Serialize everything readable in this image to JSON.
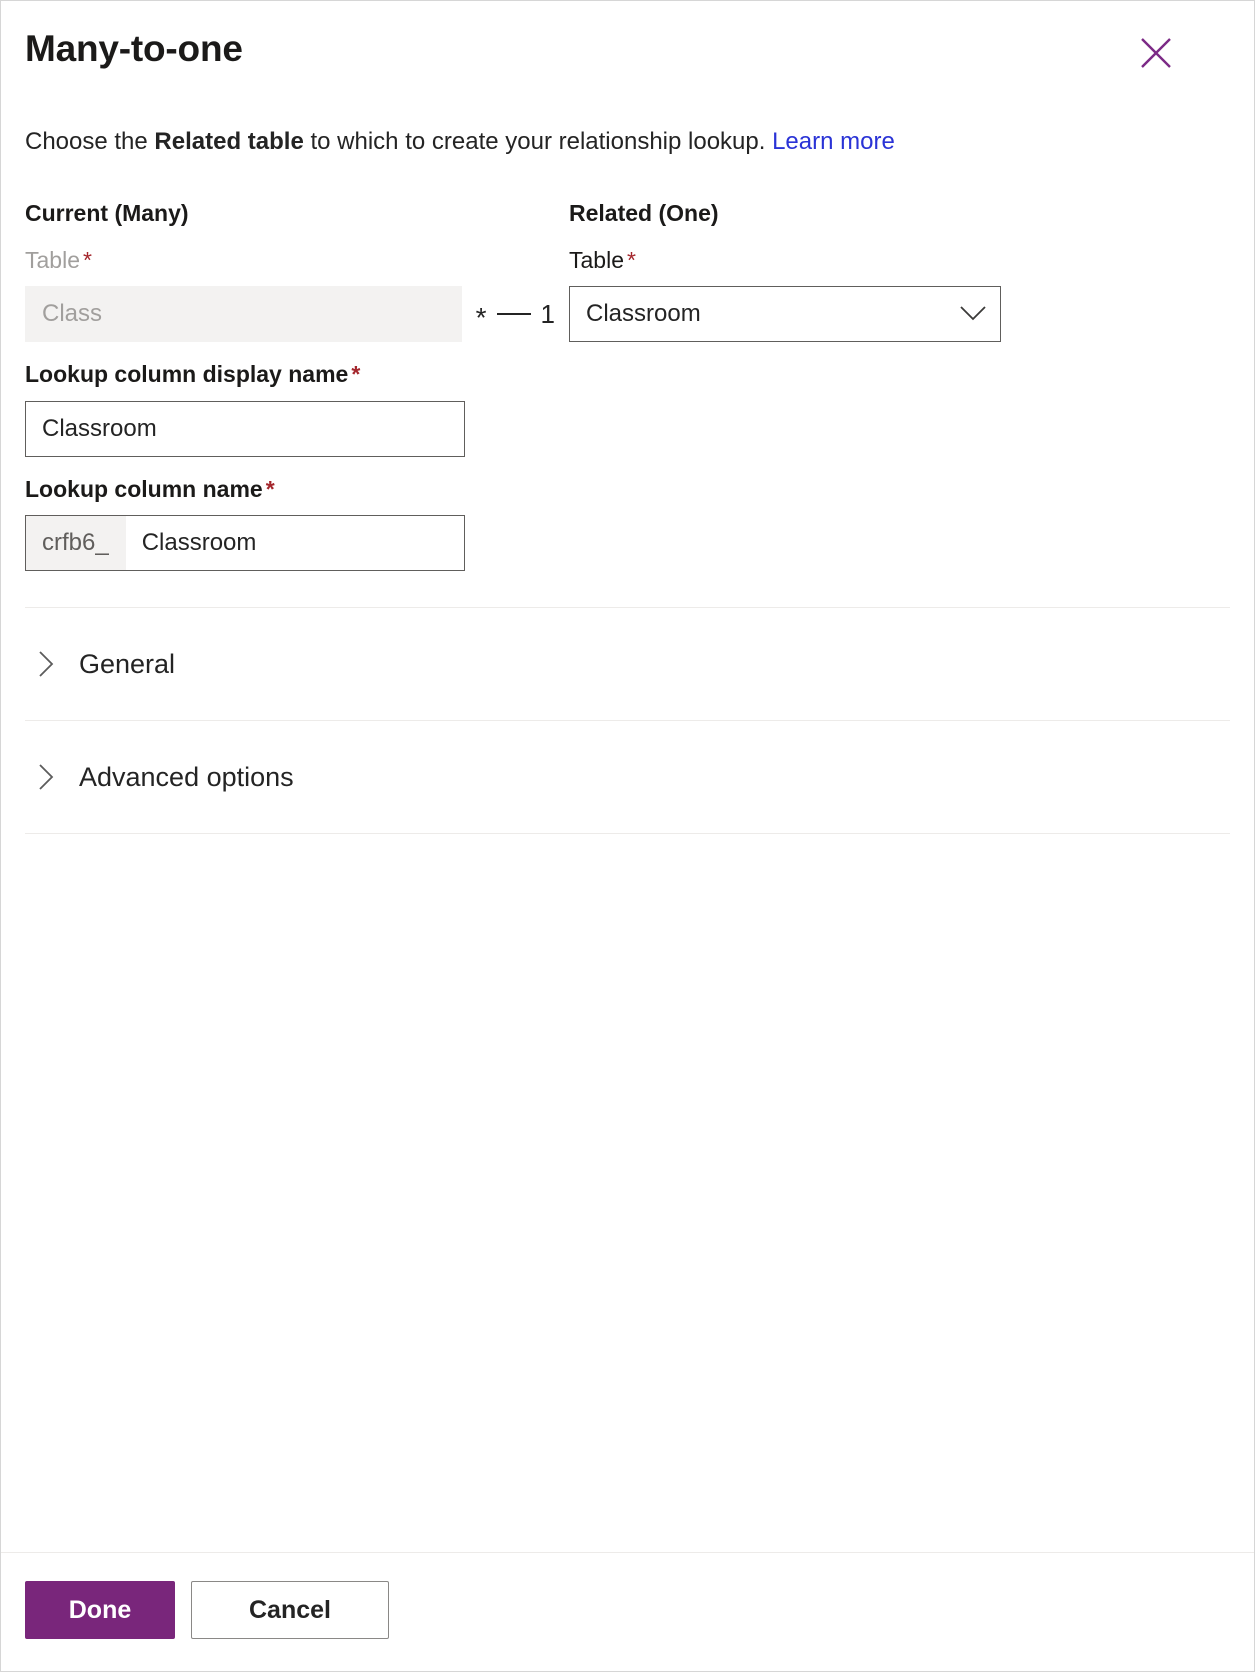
{
  "dialog": {
    "title": "Many-to-one",
    "close_icon": "close-icon",
    "subtitle": {
      "prefix": "Choose the ",
      "strong": "Related table",
      "suffix": " to which to create your relationship lookup. ",
      "link": "Learn more"
    }
  },
  "current": {
    "heading": "Current (Many)",
    "table_label": "Table",
    "required_mark": "*",
    "table_value": "Class"
  },
  "related": {
    "heading": "Related (One)",
    "table_label": "Table",
    "required_mark": "*",
    "table_value": "Classroom",
    "chevron_icon": "chevron-down-icon"
  },
  "cardinality": {
    "many": "*",
    "one": "1"
  },
  "lookup_display_name": {
    "label": "Lookup column display name",
    "required_mark": "*",
    "value": "Classroom"
  },
  "lookup_name": {
    "label": "Lookup column name",
    "required_mark": "*",
    "prefix": "crfb6_",
    "value": "Classroom"
  },
  "sections": [
    {
      "label": "General",
      "expanded": false,
      "chevron_icon": "chevron-right-icon"
    },
    {
      "label": "Advanced options",
      "expanded": false,
      "chevron_icon": "chevron-right-icon"
    }
  ],
  "footer": {
    "done_label": "Done",
    "cancel_label": "Cancel"
  },
  "colors": {
    "accent": "#79267b",
    "link": "#2a33d6",
    "required": "#a4262c",
    "disabled_bg": "#f3f2f1",
    "border": "#605e5c",
    "divider": "#edebe9"
  }
}
